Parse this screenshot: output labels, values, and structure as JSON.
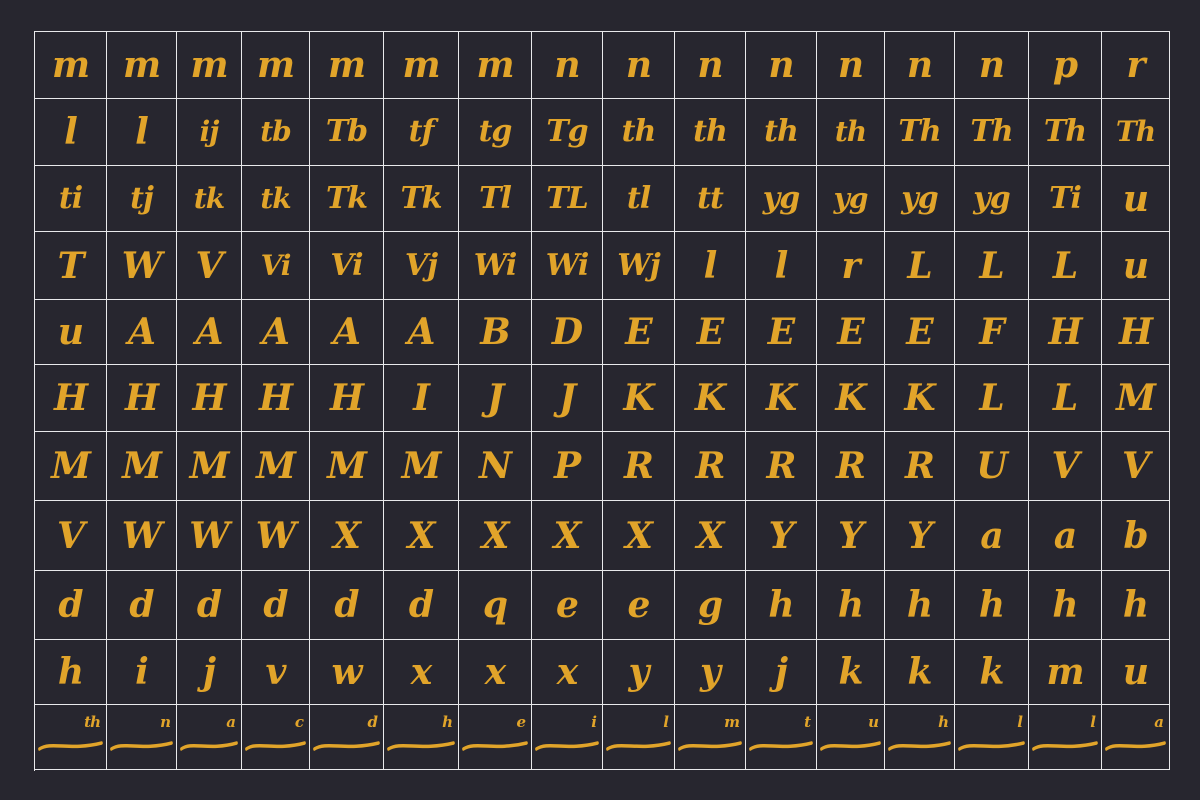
{
  "colors": {
    "background": "#27262f",
    "grid_line": "#e9e9ec",
    "glyph": "#e1a42a"
  },
  "glyph_rows": [
    [
      "m",
      "m",
      "m",
      "m",
      "m",
      "m",
      "m",
      "n",
      "n",
      "n",
      "n",
      "n",
      "n",
      "n",
      "p",
      "r"
    ],
    [
      "l",
      "l",
      "ij",
      "tb",
      "Tb",
      "tf",
      "tg",
      "Tg",
      "th",
      "th",
      "th",
      "th",
      "Th",
      "Th",
      "Th",
      "Th"
    ],
    [
      "ti",
      "tj",
      "tk",
      "tk",
      "Tk",
      "Tk",
      "Tl",
      "TL",
      "tl",
      "tt",
      "yg",
      "yg",
      "yg",
      "yg",
      "Ti",
      "u"
    ],
    [
      "T",
      "W",
      "V",
      "Vi",
      "Vi",
      "Vj",
      "Wi",
      "Wi",
      "Wj",
      "l",
      "l",
      "r",
      "L",
      "L",
      "L",
      "u"
    ],
    [
      "u",
      "A",
      "A",
      "A",
      "A",
      "A",
      "B",
      "D",
      "E",
      "E",
      "E",
      "E",
      "E",
      "F",
      "H",
      "H"
    ],
    [
      "H",
      "H",
      "H",
      "H",
      "H",
      "I",
      "J",
      "J",
      "K",
      "K",
      "K",
      "K",
      "K",
      "L",
      "L",
      "M"
    ],
    [
      "M",
      "M",
      "M",
      "M",
      "M",
      "M",
      "N",
      "P",
      "R",
      "R",
      "R",
      "R",
      "R",
      "U",
      "V",
      "V"
    ],
    [
      "V",
      "W",
      "W",
      "W",
      "X",
      "X",
      "X",
      "X",
      "X",
      "X",
      "Y",
      "Y",
      "Y",
      "a",
      "a",
      "b"
    ],
    [
      "d",
      "d",
      "d",
      "d",
      "d",
      "d",
      "q",
      "e",
      "e",
      "g",
      "h",
      "h",
      "h",
      "h",
      "h",
      "h"
    ],
    [
      "h",
      "i",
      "j",
      "v",
      "w",
      "x",
      "x",
      "x",
      "y",
      "y",
      "j",
      "k",
      "k",
      "k",
      "m",
      "u"
    ],
    [
      "th",
      "n",
      "a",
      "c",
      "d",
      "h",
      "e",
      "i",
      "l",
      "m",
      "t",
      "u",
      "h",
      "l",
      "l",
      "a"
    ]
  ]
}
